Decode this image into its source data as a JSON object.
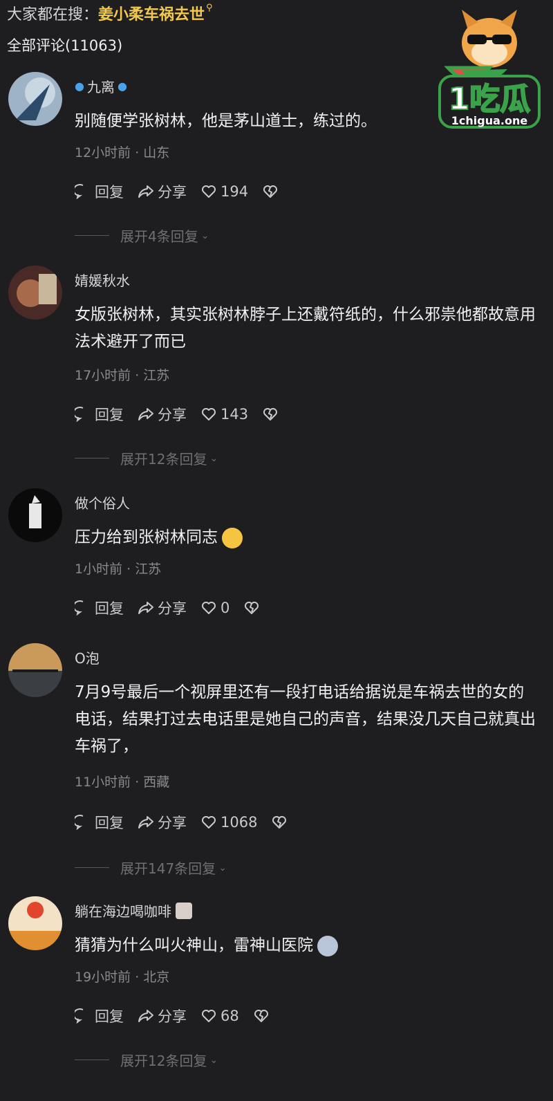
{
  "search": {
    "prefix": "大家都在搜：",
    "term": "姜小柔车祸去世",
    "icon": "search-icon"
  },
  "comment_count": "全部评论(11063)",
  "logo": {
    "text": "1吃瓜",
    "url": "1chigua.one"
  },
  "actions": {
    "reply": "回复",
    "share": "分享"
  },
  "comments": [
    {
      "username": "九离",
      "text": "别随便学张树林，他是茅山道士，练过的。",
      "meta": "12小时前 · 山东",
      "likes": "194",
      "expand": "展开4条回复"
    },
    {
      "username": "婧媛秋水",
      "text": "女版张树林，其实张树林脖子上还戴符纸的，什么邪祟他都故意用法术避开了而已",
      "meta": "17小时前 · 江苏",
      "likes": "143",
      "expand": "展开12条回复"
    },
    {
      "username": "做个俗人",
      "text": "压力给到张树林同志",
      "meta": "1小时前 · 江苏",
      "likes": "0",
      "expand": ""
    },
    {
      "username": "O泡",
      "text": "7月9号最后一个视屏里还有一段打电话给据说是车祸去世的女的电话，结果打过去电话里是她自己的声音，结果没几天自己就真出车祸了，",
      "meta": "11小时前 · 西藏",
      "likes": "1068",
      "expand": "展开147条回复"
    },
    {
      "username": "躺在海边喝咖啡",
      "text": "猜猜为什么叫火神山，雷神山医院",
      "meta": "19小时前 · 北京",
      "likes": "68",
      "expand": "展开12条回复"
    }
  ]
}
